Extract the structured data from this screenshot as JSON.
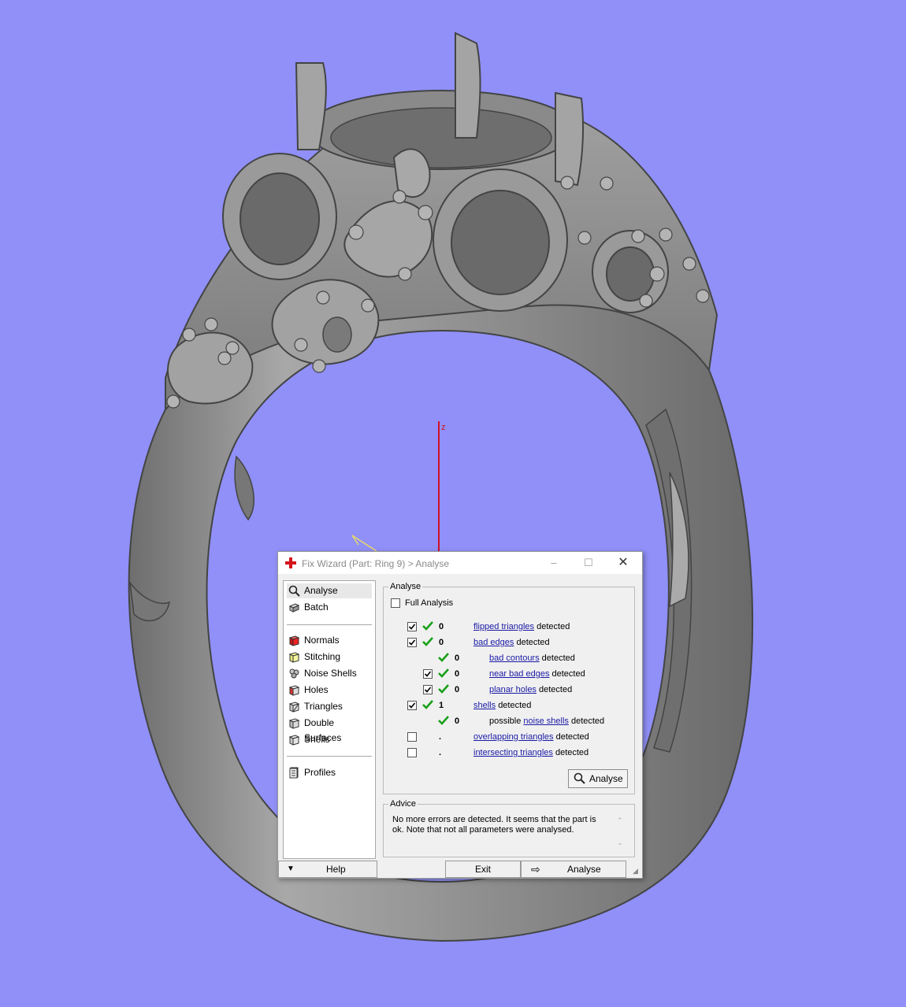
{
  "scene": {
    "background": "#9090f8",
    "model_color": "#8e8e8e",
    "axis_z_label": "z"
  },
  "dialog": {
    "title": "Fix Wizard (Part: Ring 9) > Analyse",
    "minimize_icon": "minimize-icon",
    "maximize_icon": "maximize-icon",
    "close_icon": "close-icon"
  },
  "sidebar": {
    "groups": [
      [
        {
          "label": "Analyse",
          "icon": "magnifier-icon",
          "selected": true
        },
        {
          "label": "Batch",
          "icon": "batch-icon",
          "selected": false
        }
      ],
      [
        {
          "label": "Normals",
          "icon": "normals-cube-icon",
          "selected": false
        },
        {
          "label": "Stitching",
          "icon": "stitching-cube-icon",
          "selected": false
        },
        {
          "label": "Noise Shells",
          "icon": "noise-shells-icon",
          "selected": false
        },
        {
          "label": "Holes",
          "icon": "holes-cube-icon",
          "selected": false
        },
        {
          "label": "Triangles",
          "icon": "triangles-cube-icon",
          "selected": false
        },
        {
          "label": "Double Surfaces",
          "icon": "double-surfaces-icon",
          "selected": false
        },
        {
          "label": "Shells",
          "icon": "shells-cube-icon",
          "selected": false
        }
      ],
      [
        {
          "label": "Profiles",
          "icon": "profiles-icon",
          "selected": false
        }
      ]
    ]
  },
  "analyse": {
    "legend": "Analyse",
    "full_analysis_label": "Full Analysis",
    "full_analysis_checked": false,
    "rows": [
      {
        "indent": 0,
        "checkbox": true,
        "checked": true,
        "status": "ok",
        "count": "0",
        "prefix": "",
        "link": "flipped triangles",
        "suffix": "detected"
      },
      {
        "indent": 0,
        "checkbox": true,
        "checked": true,
        "status": "ok",
        "count": "0",
        "prefix": "",
        "link": "bad edges",
        "suffix": "detected"
      },
      {
        "indent": 1,
        "checkbox": false,
        "checked": false,
        "status": "ok",
        "count": "0",
        "prefix": "",
        "link": "bad contours",
        "suffix": "detected"
      },
      {
        "indent": 1,
        "checkbox": true,
        "checked": true,
        "status": "ok",
        "count": "0",
        "prefix": "",
        "link": "near bad edges",
        "suffix": "detected"
      },
      {
        "indent": 1,
        "checkbox": true,
        "checked": true,
        "status": "ok",
        "count": "0",
        "prefix": "",
        "link": "planar holes",
        "suffix": "detected"
      },
      {
        "indent": 0,
        "checkbox": true,
        "checked": true,
        "status": "ok",
        "count": "1",
        "prefix": "",
        "link": "shells",
        "suffix": "detected"
      },
      {
        "indent": 1,
        "checkbox": false,
        "checked": false,
        "status": "ok",
        "count": "0",
        "prefix": "possible ",
        "link": "noise shells",
        "suffix": "detected"
      },
      {
        "indent": 0,
        "checkbox": true,
        "checked": false,
        "status": "none",
        "count": ".",
        "prefix": "",
        "link": "overlapping triangles",
        "suffix": "detected"
      },
      {
        "indent": 0,
        "checkbox": true,
        "checked": false,
        "status": "none",
        "count": ".",
        "prefix": "",
        "link": "intersecting triangles",
        "suffix": "detected"
      }
    ],
    "analyse_button": "Analyse"
  },
  "advice": {
    "legend": "Advice",
    "text": "No more errors are detected. It seems that the part is ok. Note that not all parameters were analysed."
  },
  "bottom": {
    "help": "Help",
    "exit": "Exit",
    "analyse": "Analyse"
  }
}
